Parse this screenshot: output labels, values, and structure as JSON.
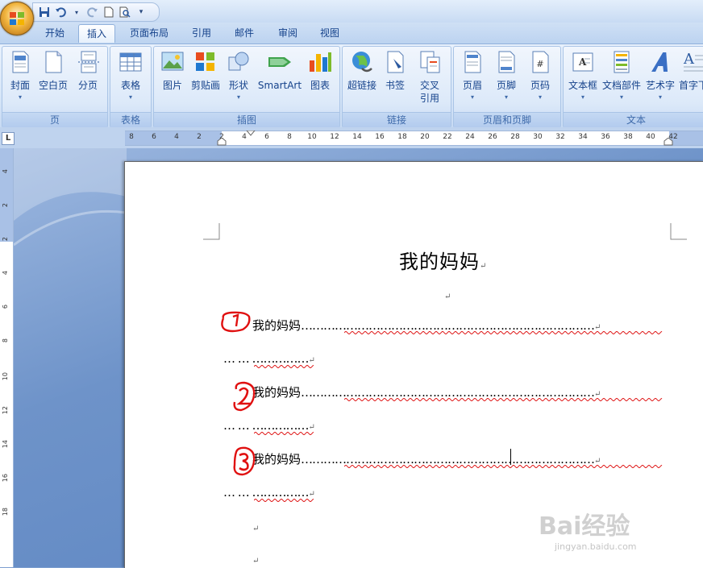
{
  "qat": {
    "icons": [
      "save-icon",
      "undo-icon",
      "redo-icon",
      "new-doc-icon",
      "print-preview-icon",
      "customize-icon"
    ]
  },
  "tabs": [
    {
      "label": "开始",
      "active": false
    },
    {
      "label": "插入",
      "active": true
    },
    {
      "label": "页面布局",
      "active": false
    },
    {
      "label": "引用",
      "active": false
    },
    {
      "label": "邮件",
      "active": false
    },
    {
      "label": "审阅",
      "active": false
    },
    {
      "label": "视图",
      "active": false
    }
  ],
  "ribbon": {
    "groups": {
      "page": "页",
      "table": "表格",
      "illustrations": "插图",
      "links": "链接",
      "header_footer": "页眉和页脚",
      "text": "文本"
    },
    "buttons": {
      "cover": "封面",
      "blank_page": "空白页",
      "page_break": "分页",
      "table": "表格",
      "picture": "图片",
      "clipart": "剪贴画",
      "shapes": "形状",
      "smartart": "SmartArt",
      "chart": "图表",
      "hyperlink": "超链接",
      "bookmark": "书签",
      "cross_ref_1": "交叉",
      "cross_ref_2": "引用",
      "header": "页眉",
      "footer": "页脚",
      "page_number": "页码",
      "textbox": "文本框",
      "quick_parts": "文档部件",
      "wordart": "艺术字",
      "dropcap": "首字下"
    }
  },
  "ruler": {
    "labels": [
      "8",
      "6",
      "4",
      "2",
      "2",
      "4",
      "6",
      "8",
      "10",
      "12",
      "14",
      "16",
      "18",
      "20",
      "22",
      "24",
      "26",
      "28",
      "30",
      "32",
      "34",
      "36",
      "38",
      "40",
      "42"
    ],
    "vlabels": [
      "4",
      "2",
      "2",
      "4",
      "6",
      "8",
      "10",
      "12",
      "14",
      "16",
      "18"
    ],
    "tab_selector": "L"
  },
  "document": {
    "title": "我的妈妈",
    "return_mark": "↵",
    "entry_text": "我的妈妈",
    "leader_line1": "……………………………………………………………………",
    "leader_line2": "… … ……………",
    "marks": [
      "1",
      "2",
      "3"
    ]
  },
  "watermark": {
    "brand": "Bai经验",
    "url": "jingyan.baidu.com"
  },
  "colors": {
    "ribbon_text": "#15428b",
    "mark_red": "#e01010",
    "spell_wave": "#e02020"
  }
}
